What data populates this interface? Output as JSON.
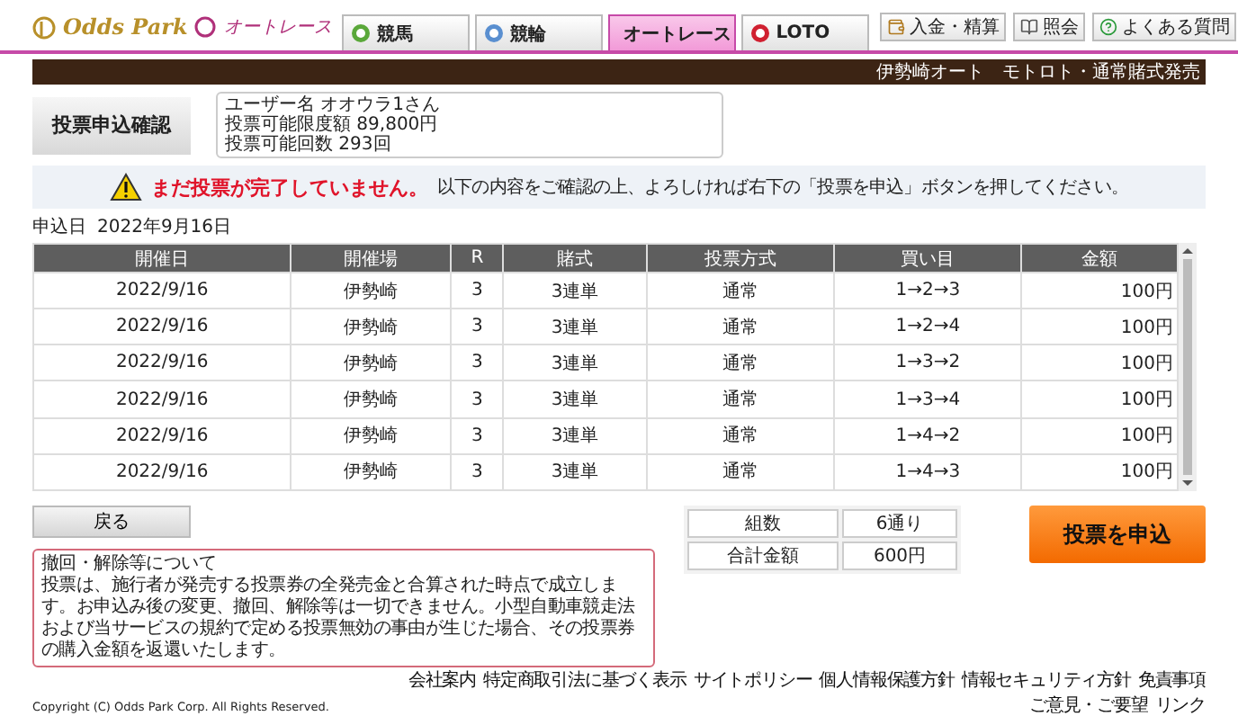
{
  "header": {
    "logo_text": "Odds Park",
    "sub_logo_text": "オートレース",
    "tabs": [
      {
        "label": "競馬",
        "kind": "horse",
        "selected": false
      },
      {
        "label": "競輪",
        "kind": "keirin",
        "selected": false
      },
      {
        "label": "オートレース",
        "kind": "auto",
        "selected": true
      },
      {
        "label": "LOTO",
        "kind": "loto",
        "selected": false
      }
    ],
    "util_buttons": [
      {
        "label": "入金・精算",
        "kind": "deposit"
      },
      {
        "label": "照会",
        "kind": "inquiry"
      },
      {
        "label": "よくある質問",
        "kind": "faq"
      }
    ],
    "banner_text": "伊勢崎オート　モトロト・通常賭式発売"
  },
  "page_title": "投票申込確認",
  "user_info": [
    "ユーザー名 オオウラ1さん",
    "投票可能限度額  89,800円",
    "投票可能回数  293回"
  ],
  "warning": {
    "title": "まだ投票が完了していません。",
    "message": "以下の内容をご確認の上、よろしければ右下の「投票を申込」ボタンを押してください。"
  },
  "apply_date": {
    "label": "申込日",
    "value": "2022年9月16日"
  },
  "table": {
    "columns": [
      "開催日",
      "開催場",
      "R",
      "賭式",
      "投票方式",
      "買い目",
      "金額"
    ],
    "rows": [
      [
        "2022/9/16",
        "伊勢崎",
        "3",
        "3連単",
        "通常",
        "1→2→3",
        "100円"
      ],
      [
        "2022/9/16",
        "伊勢崎",
        "3",
        "3連単",
        "通常",
        "1→2→4",
        "100円"
      ],
      [
        "2022/9/16",
        "伊勢崎",
        "3",
        "3連単",
        "通常",
        "1→3→2",
        "100円"
      ],
      [
        "2022/9/16",
        "伊勢崎",
        "3",
        "3連単",
        "通常",
        "1→3→4",
        "100円"
      ],
      [
        "2022/9/16",
        "伊勢崎",
        "3",
        "3連単",
        "通常",
        "1→4→2",
        "100円"
      ],
      [
        "2022/9/16",
        "伊勢崎",
        "3",
        "3連単",
        "通常",
        "1→4→3",
        "100円"
      ]
    ]
  },
  "back_button": "戻る",
  "notice": {
    "title": "撤回・解除等について",
    "body": "投票は、施行者が発売する投票券の全発売金と合算された時点で成立します。お申込み後の変更、撤回、解除等は一切できません。小型自動車競走法および当サービスの規約で定める投票無効の事由が生じた場合、その投票券の購入金額を返還いたします。"
  },
  "summary": [
    {
      "label": "組数",
      "value": "6通り"
    },
    {
      "label": "合計金額",
      "value": "600円"
    }
  ],
  "submit_button": "投票を申込",
  "footer": {
    "copyright": "Copyright (C) Odds Park Corp. All Rights Reserved.",
    "links": [
      "会社案内",
      "特定商取引法に基づく表示",
      "サイトポリシー",
      "個人情報保護方針",
      "情報セキュリティ方針",
      "免責事項",
      "ご意見・ご要望",
      "リンク"
    ]
  }
}
